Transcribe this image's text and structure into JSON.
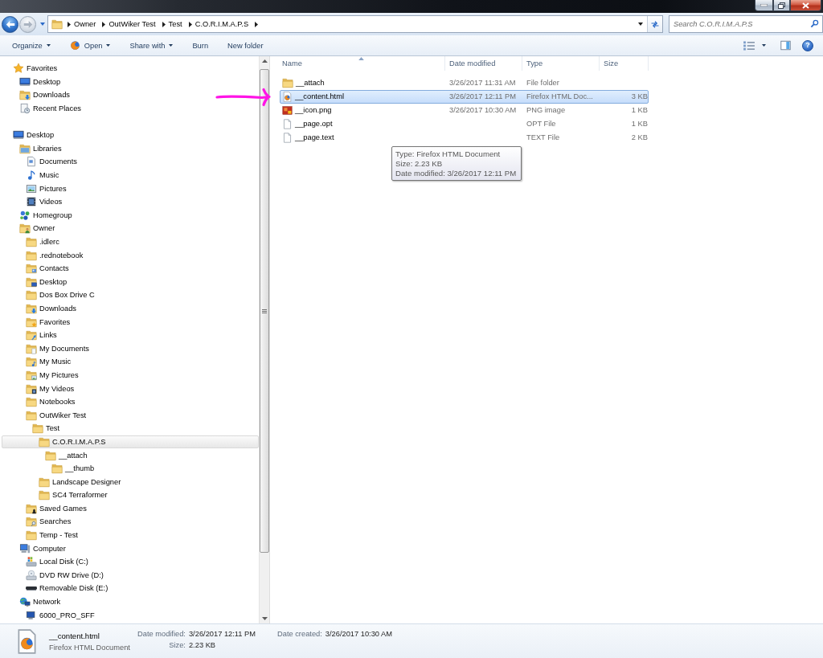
{
  "navigation": {
    "back": {
      "disabled": false
    },
    "forward": {
      "disabled": true
    }
  },
  "address_bar": {
    "crumbs": [
      "Owner",
      "OutWiker Test",
      "Test",
      "C.O.R.I.M.A.P.S"
    ]
  },
  "search": {
    "placeholder": "Search C.O.R.I.M.A.P.S"
  },
  "command_bar": {
    "buttons": [
      {
        "label": "Organize",
        "kind": "menu"
      },
      {
        "label": "Open",
        "kind": "app_menu"
      },
      {
        "label": "Share with",
        "kind": "menu"
      },
      {
        "label": "Burn",
        "kind": "button"
      },
      {
        "label": "New folder",
        "kind": "button"
      }
    ],
    "help_label": "?"
  },
  "navigation_pane": {
    "items": [
      {
        "label": "Favorites",
        "kind": "star",
        "selected": false,
        "children": [
          {
            "label": "Desktop",
            "kind": "desktop",
            "selected": false
          },
          {
            "label": "Downloads",
            "kind": "downloads_folder",
            "selected": false
          },
          {
            "label": "Recent Places",
            "kind": "recent",
            "selected": false
          }
        ]
      },
      {
        "label": "Desktop",
        "kind": "desktop",
        "selected": false,
        "children": [
          {
            "label": "Libraries",
            "kind": "library",
            "selected": false,
            "children": [
              {
                "label": "Documents",
                "kind": "documents",
                "selected": false
              },
              {
                "label": "Music",
                "kind": "music",
                "selected": false
              },
              {
                "label": "Pictures",
                "kind": "pictures",
                "selected": false
              },
              {
                "label": "Videos",
                "kind": "videos",
                "selected": false
              }
            ]
          },
          {
            "label": "Homegroup",
            "kind": "homegroup",
            "selected": false
          },
          {
            "label": "Owner",
            "kind": "user_folder",
            "selected": false,
            "children": [
              {
                "label": ".idlerc",
                "kind": "folder",
                "selected": false
              },
              {
                "label": ".rednotebook",
                "kind": "folder",
                "selected": false
              },
              {
                "label": "Contacts",
                "kind": "contacts_folder",
                "selected": false
              },
              {
                "label": "Desktop",
                "kind": "desktop_folder",
                "selected": false
              },
              {
                "label": "Dos Box Drive C",
                "kind": "folder",
                "selected": false
              },
              {
                "label": "Downloads",
                "kind": "downloads_folder",
                "selected": false
              },
              {
                "label": "Favorites",
                "kind": "favorites_folder",
                "selected": false
              },
              {
                "label": "Links",
                "kind": "links_folder",
                "selected": false
              },
              {
                "label": "My Documents",
                "kind": "documents_folder",
                "selected": false
              },
              {
                "label": "My Music",
                "kind": "music_folder",
                "selected": false
              },
              {
                "label": "My Pictures",
                "kind": "pictures_folder",
                "selected": false
              },
              {
                "label": "My Videos",
                "kind": "videos_folder",
                "selected": false
              },
              {
                "label": "Notebooks",
                "kind": "folder",
                "selected": false
              },
              {
                "label": "OutWiker Test",
                "kind": "folder",
                "selected": false,
                "children": [
                  {
                    "label": "Test",
                    "kind": "folder",
                    "selected": false,
                    "children": [
                      {
                        "label": "C.O.R.I.M.A.P.S",
                        "kind": "folder",
                        "selected": true,
                        "children": [
                          {
                            "label": "__attach",
                            "kind": "folder",
                            "selected": false,
                            "children": [
                              {
                                "label": "__thumb",
                                "kind": "folder",
                                "selected": false
                              }
                            ]
                          }
                        ]
                      },
                      {
                        "label": "Landscape Designer",
                        "kind": "folder",
                        "selected": false
                      },
                      {
                        "label": "SC4 Terraformer",
                        "kind": "folder",
                        "selected": false
                      }
                    ]
                  }
                ]
              },
              {
                "label": "Saved Games",
                "kind": "games_folder",
                "selected": false
              },
              {
                "label": "Searches",
                "kind": "searches_folder",
                "selected": false
              },
              {
                "label": "Temp - Test",
                "kind": "folder",
                "selected": false
              }
            ]
          },
          {
            "label": "Computer",
            "kind": "computer",
            "selected": false,
            "children": [
              {
                "label": "Local Disk (C:)",
                "kind": "disk",
                "selected": false
              },
              {
                "label": "DVD RW Drive (D:)",
                "kind": "dvd",
                "selected": false
              },
              {
                "label": "Removable Disk (E:)",
                "kind": "removable",
                "selected": false
              }
            ]
          },
          {
            "label": "Network",
            "kind": "network",
            "selected": false,
            "children": [
              {
                "label": "6000_PRO_SFF",
                "kind": "network_computer",
                "selected": false
              }
            ]
          }
        ]
      }
    ]
  },
  "file_list": {
    "columns": [
      {
        "label": "Name",
        "sorted": true
      },
      {
        "label": "Date modified",
        "sorted": false
      },
      {
        "label": "Type",
        "sorted": false
      },
      {
        "label": "Size",
        "sorted": false
      }
    ],
    "rows": [
      {
        "kind": "folder",
        "name": "__attach",
        "date_modified": "3/26/2017 11:31 AM",
        "type": "File folder",
        "selected": false
      },
      {
        "kind": "html",
        "name": "__content.html",
        "date_modified": "3/26/2017 12:11 PM",
        "type": "Firefox HTML Doc...",
        "size": "3 KB",
        "selected": true
      },
      {
        "kind": "image",
        "name": "__icon.png",
        "date_modified": "3/26/2017 10:30 AM",
        "type": "PNG image",
        "size": "1 KB",
        "selected": false
      },
      {
        "kind": "file",
        "name": "__page.opt",
        "type": "OPT File",
        "size": "1 KB",
        "selected": false
      },
      {
        "kind": "file",
        "name": "__page.text",
        "type": "TEXT File",
        "size": "2 KB",
        "selected": false
      }
    ]
  },
  "tooltip": {
    "lines": [
      "Type: Firefox HTML Document",
      "Size: 2.23 KB",
      "Date modified: 3/26/2017 12:11 PM"
    ]
  },
  "details_pane": {
    "name": "__content.html",
    "type": "Firefox HTML Document",
    "property_columns": [
      [
        {
          "label": "Date modified:",
          "value": "3/26/2017 12:11 PM"
        },
        {
          "label": "Size:",
          "value": "2.23 KB"
        }
      ],
      [
        {
          "label": "Date created:",
          "value": "3/26/2017 10:30 AM"
        }
      ]
    ]
  }
}
